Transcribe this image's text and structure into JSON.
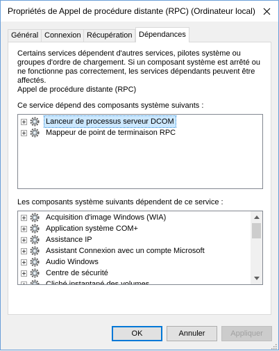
{
  "window": {
    "title": "Propriétés de Appel de procédure distante (RPC) (Ordinateur local)"
  },
  "tabs": [
    {
      "label": "Général"
    },
    {
      "label": "Connexion"
    },
    {
      "label": "Récupération"
    },
    {
      "label": "Dépendances",
      "active": true
    }
  ],
  "panel": {
    "description": "Certains services dépendent d'autres services, pilotes système ou groupes d'ordre de chargement. Si un composant système est arrêté ou ne fonctionne pas correctement, les services dépendants peuvent être affectés.",
    "service_name": "Appel de procédure distante (RPC)",
    "depends_on_label": "Ce service dépend des composants système suivants :",
    "depends_on": [
      {
        "label": "Lanceur de processus serveur DCOM",
        "selected": true,
        "icon": "gear-icon"
      },
      {
        "label": "Mappeur de point de terminaison RPC",
        "selected": false,
        "icon": "gear-icon"
      }
    ],
    "dependents_label": "Les composants système suivants dépendent de ce service :",
    "dependents": [
      {
        "label": "Acquisition d'image Windows (WIA)",
        "icon": "gear-icon"
      },
      {
        "label": "Application système COM+",
        "icon": "gear-icon"
      },
      {
        "label": "Assistance IP",
        "icon": "gear-icon"
      },
      {
        "label": "Assistant Connexion avec un compte Microsoft",
        "icon": "gear-icon"
      },
      {
        "label": "Audio Windows",
        "icon": "gear-icon"
      },
      {
        "label": "Centre de sécurité",
        "icon": "gear-icon"
      },
      {
        "label": "Cliché instantané des volumes",
        "icon": "gear-icon"
      }
    ]
  },
  "buttons": {
    "ok": "OK",
    "cancel": "Annuler",
    "apply": "Appliquer"
  },
  "colors": {
    "selection": "#cce8ff",
    "accent": "#0078d7"
  }
}
